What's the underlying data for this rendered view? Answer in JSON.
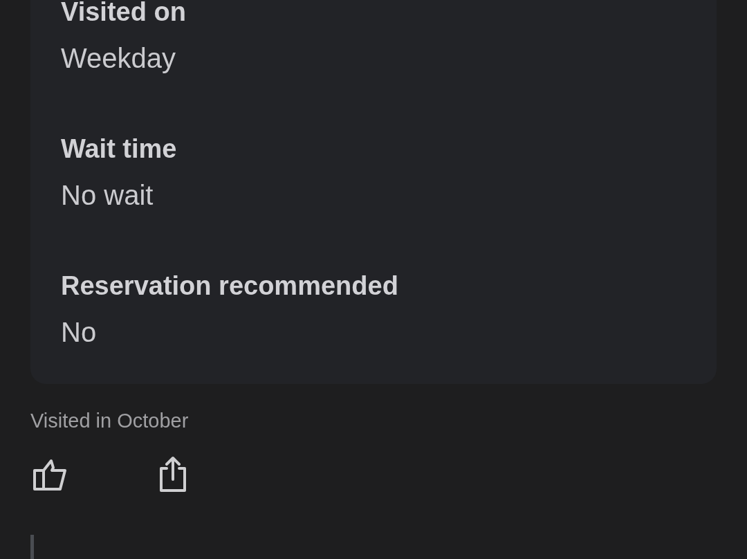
{
  "details": [
    {
      "label": "Visited on",
      "value": "Weekday"
    },
    {
      "label": "Wait time",
      "value": "No wait"
    },
    {
      "label": "Reservation recommended",
      "value": "No"
    }
  ],
  "visit_note": "Visited in October"
}
